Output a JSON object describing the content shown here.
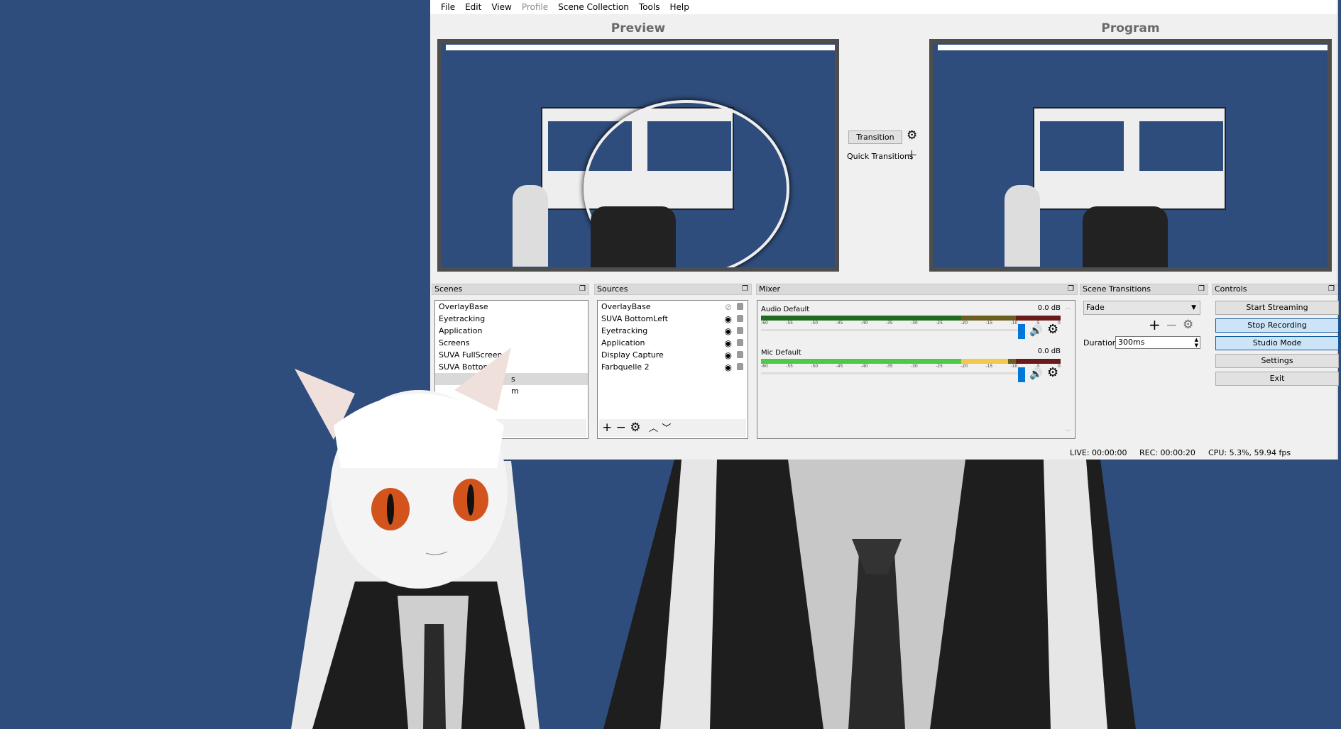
{
  "menu": [
    "File",
    "Edit",
    "View",
    "Profile",
    "Scene Collection",
    "Tools",
    "Help"
  ],
  "preview": {
    "title": "Preview"
  },
  "program": {
    "title": "Program"
  },
  "transition": {
    "button": "Transition",
    "quick": "Quick Transitions"
  },
  "docks": {
    "scenes": "Scenes",
    "sources": "Sources",
    "mixer": "Mixer",
    "scene_transitions": "Scene Transitions",
    "controls": "Controls"
  },
  "scenes": [
    "OverlayBase",
    "Eyetracking",
    "Application",
    "Screens",
    "SUVA FullScreen",
    "SUVA BottomLeft",
    "s",
    "m"
  ],
  "sources": [
    {
      "name": "OverlayBase",
      "visible": false
    },
    {
      "name": "SUVA BottomLeft",
      "visible": true
    },
    {
      "name": "Eyetracking",
      "visible": true
    },
    {
      "name": "Application",
      "visible": true
    },
    {
      "name": "Display Capture",
      "visible": true
    },
    {
      "name": "Farbquelle 2",
      "visible": true
    }
  ],
  "mixer": {
    "channels": [
      {
        "name": "Audio Default",
        "db": "0.0 dB",
        "volume": 1.0
      },
      {
        "name": "Mic Default",
        "db": "0.0 dB",
        "volume": 1.0
      }
    ],
    "ticks": [
      "-60",
      "-55",
      "-50",
      "-45",
      "-40",
      "-35",
      "-30",
      "-25",
      "-20",
      "-15",
      "-10",
      "-5",
      "0"
    ]
  },
  "scene_transitions": {
    "selected": "Fade",
    "duration_label": "Duration",
    "duration": "300ms"
  },
  "controls": [
    "Start Streaming",
    "Stop Recording",
    "Studio Mode",
    "Settings",
    "Exit"
  ],
  "status": {
    "live": "LIVE: 00:00:00",
    "rec": "REC: 00:00:20",
    "cpu": "CPU: 5.3%, 59.94 fps"
  },
  "colors": {
    "desktop": "#2f4d7c",
    "active_button": "#cce4f7",
    "volume_handle": "#0078d7"
  }
}
